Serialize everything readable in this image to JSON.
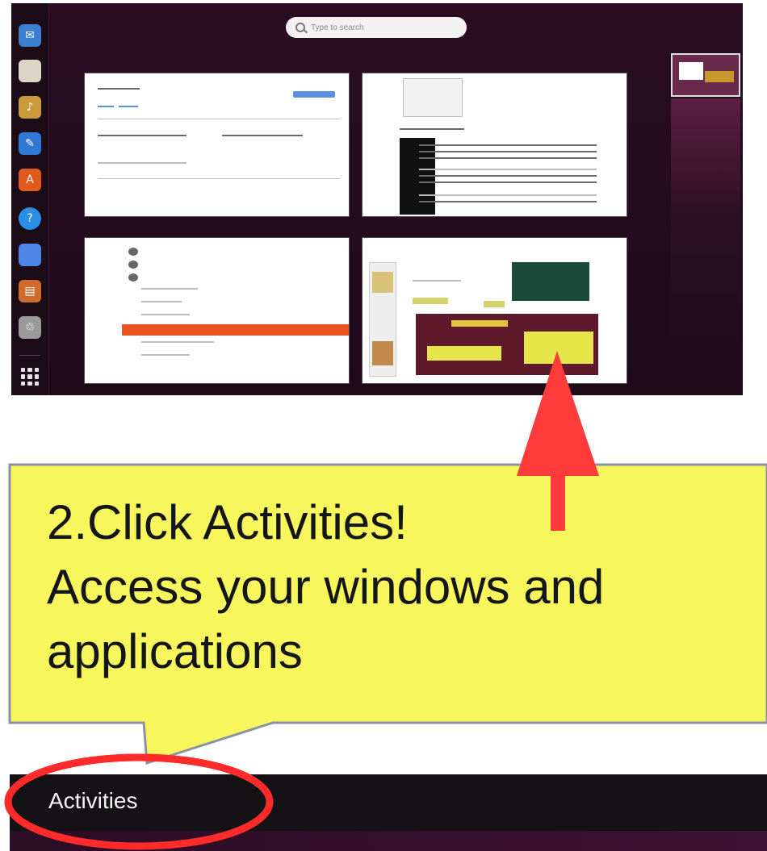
{
  "overview": {
    "search_placeholder": "Type to search",
    "dock_icons": [
      "thunderbird-icon",
      "files-icon",
      "rhythmbox-icon",
      "writer-icon",
      "software-center-icon",
      "help-icon",
      "editor-icon",
      "impress-icon",
      "trash-icon"
    ],
    "colors": {
      "background": "#2a0f22",
      "accent_orange": "#e95420"
    }
  },
  "callout": {
    "line1": "2.Click Activities!",
    "line2": "Access your windows and",
    "line3": "applications",
    "fill_color": "#f7f65c",
    "arrow_color": "#ff3b3b"
  },
  "taskbar": {
    "activities_label": "Activities",
    "highlight_color": "#ff2b2b"
  }
}
